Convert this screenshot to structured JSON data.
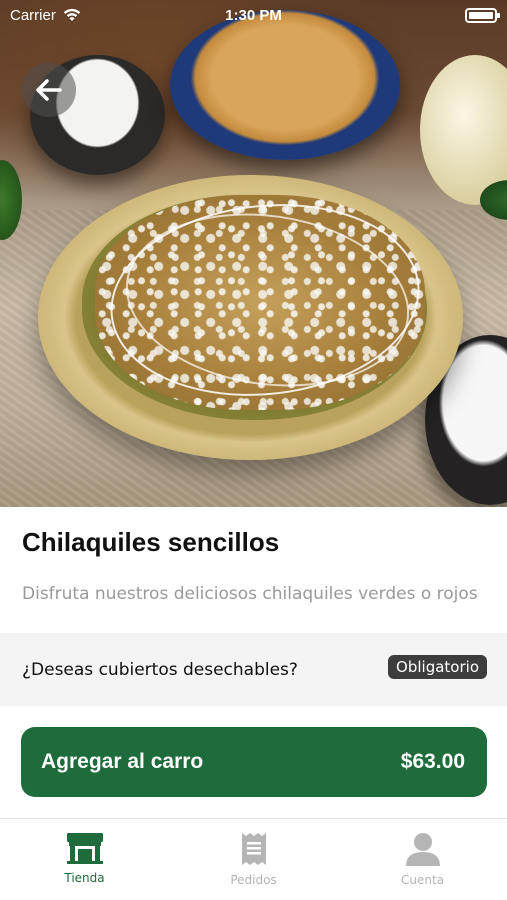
{
  "status_bar": {
    "carrier": "Carrier",
    "time": "1:30 PM"
  },
  "icons": {
    "back": "arrow-left-icon",
    "wifi": "wifi-icon",
    "battery": "battery-icon",
    "store": "store-icon",
    "orders": "receipt-icon",
    "account": "person-icon"
  },
  "product": {
    "title": "Chilaquiles sencillos",
    "description": "Disfruta nuestros deliciosos chilaquiles verdes o rojos"
  },
  "option": {
    "label": "¿Deseas cubiertos desechables?",
    "badge": "Obligatorio"
  },
  "cart_button": {
    "label": "Agregar al carro",
    "price": "$63.00"
  },
  "tabs": [
    {
      "label": "Tienda",
      "active": true
    },
    {
      "label": "Pedidos",
      "active": false
    },
    {
      "label": "Cuenta",
      "active": false
    }
  ],
  "colors": {
    "brand_green": "#1e6b3c",
    "badge_dark": "#3d3d3d",
    "inactive_gray": "#b5b5b5"
  }
}
